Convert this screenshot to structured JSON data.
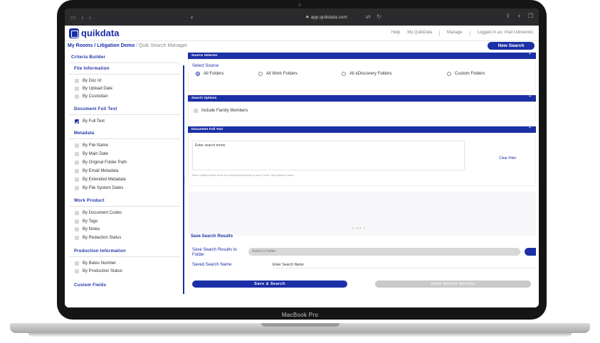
{
  "device": {
    "label": "MacBook Pro"
  },
  "browser": {
    "url": "app.quikdata.com",
    "icons": [
      "sidebar-icon",
      "back-icon",
      "forward-icon",
      "shield-icon",
      "lock-icon",
      "translate-icon",
      "reload-icon",
      "share-icon",
      "new-tab-icon",
      "tabs-icon"
    ]
  },
  "app": {
    "logo": "quikdata",
    "nav": {
      "help": "Help",
      "my": "My QuikData",
      "manage": "Manage",
      "logged": "Logged in as: Vlad Udovenko"
    },
    "breadcrumb": {
      "rooms": "My Rooms",
      "sep1": " / ",
      "demo": "Litigation Demo",
      "sep2": " / ",
      "current": "Quik Search Manager"
    },
    "new_search": "New Search"
  },
  "sidebar": {
    "title": "Criteria Builder",
    "sections": {
      "file_info": {
        "title": "File Information",
        "items": [
          "By Doc Id",
          "By Upload Date",
          "By Custodian"
        ]
      },
      "full_text": {
        "title": "Document Full Text",
        "items": [
          "By Full Text"
        ]
      },
      "metadata": {
        "title": "Metadata",
        "items": [
          "By File Name",
          "By Main Date",
          "By Original Folder Path",
          "By Email Metadata",
          "By Extended Metadata",
          "By File System Dates"
        ]
      },
      "work_product": {
        "title": "Work Product",
        "items": [
          "By Document Codes",
          "By Tags",
          "By Notes",
          "By Redaction Status"
        ]
      },
      "production": {
        "title": "Production Information",
        "items": [
          "By Bates Number",
          "By Production Status"
        ]
      },
      "custom": {
        "title": "Custom Fields"
      }
    }
  },
  "main": {
    "source": {
      "header": "Source Selector",
      "label": "Select Source",
      "options": [
        "All Folders",
        "All Work Folders",
        "All eDiscovery Folders",
        "Custom Folders"
      ],
      "selected": "All Folders"
    },
    "options": {
      "header": "Search Options",
      "family": "Include Family Members"
    },
    "fulltext": {
      "header": "Document Full Text",
      "placeholder": "Enter search terms",
      "hint": "Enter multiple search terms as comma-separated list or press \"Enter\" key between values",
      "clear": "Clear Filter"
    },
    "save": {
      "title": "Save Search Results",
      "folder_label": "Save Search Results to Folder",
      "folder_placeholder": "Select a Folder",
      "name_label": "Saved Search Name",
      "name_placeholder": "Enter Search Name",
      "save_button": "Save & Search",
      "open_button": "Open Search Results"
    }
  },
  "colors": {
    "brand": "#1b2fa6",
    "disabled": "#c9c9c9"
  }
}
